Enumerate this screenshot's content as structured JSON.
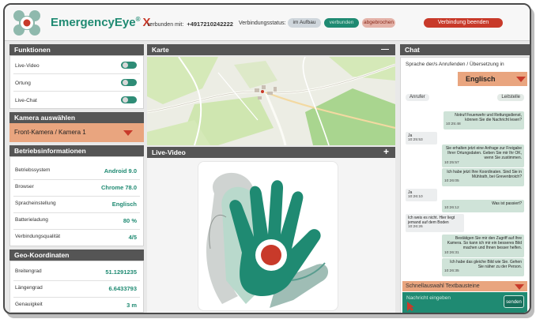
{
  "app": {
    "brand": "EmergencyEye",
    "brand_suffix": "X",
    "reg_mark": "®"
  },
  "header": {
    "connected_label": "verbunden mit:",
    "phone": "+4917210242222",
    "status_label": "Verbindungsstatus:",
    "status_building": "im Aufbau",
    "status_connected": "verbunden",
    "status_aborted": "abgebrochen",
    "end_button": "Verbindung beenden"
  },
  "functions": {
    "title": "Funktionen",
    "items": [
      {
        "label": "Live-Video",
        "on": true
      },
      {
        "label": "Ortung",
        "on": true
      },
      {
        "label": "Live-Chat",
        "on": true
      }
    ]
  },
  "camera": {
    "title": "Kamera auswählen",
    "selected": "Front-Kamera / Kamera 1"
  },
  "operating": {
    "title": "Betriebsinformationen",
    "rows": [
      {
        "label": "Betriebssystem",
        "value": "Android 9.0"
      },
      {
        "label": "Browser",
        "value": "Chrome 78.0"
      },
      {
        "label": "Spracheinstellung",
        "value": "Englisch"
      },
      {
        "label": "Batterieladung",
        "value": "80 %"
      },
      {
        "label": "Verbindungsqualität",
        "value": "4/5"
      }
    ]
  },
  "geo": {
    "title": "Geo-Koordinaten",
    "rows": [
      {
        "label": "Breitengrad",
        "value": "51.1291235"
      },
      {
        "label": "Längengrad",
        "value": "6.6433793"
      },
      {
        "label": "Genauigkeit",
        "value": "3 m"
      }
    ]
  },
  "map": {
    "title": "Karte",
    "collapse_symbol": "—"
  },
  "video": {
    "title": "Live-Video",
    "expand_symbol": "+"
  },
  "chat": {
    "title": "Chat",
    "language_label": "Sprache der/s Anrufenden / Übersetzung in",
    "language": "Englisch",
    "caller_tab": "Anrufer",
    "control_tab": "Leitstelle",
    "messages": [
      {
        "side": "right",
        "text": "Notruf Feuerwehr und Rettungsdienst, können Sie die Nachricht lesen?",
        "time": "10:25:48"
      },
      {
        "side": "left",
        "text": "Ja",
        "time": "10:25:53"
      },
      {
        "side": "right",
        "text": "Sie erhalten jetzt eine Anfrage zur Freigabe Ihrer Ortungsdaten. Geben Sie mir Ihr OK, wenn Sie zustimmen.",
        "time": "10:25:57"
      },
      {
        "side": "right",
        "text": "Ich habe jetzt Ihre Koordinaten. Sind Sie in Mühlrath, bei Grevenbroich?",
        "time": "10:26:05"
      },
      {
        "side": "left",
        "text": "Ja",
        "time": "10:26:10"
      },
      {
        "side": "right",
        "text": "Was ist passiert?",
        "time": "10:26:12"
      },
      {
        "side": "left",
        "text": "Ich weis es nicht. Hier liegt jemand auf dem Boden",
        "time": "10:26:26"
      },
      {
        "side": "right",
        "text": "Bestätigen Sie mir den Zugriff auf Ihre Kamera. So kann ich mir ein besseres Bild machen und Ihnen besser helfen.",
        "time": "10:26:31"
      },
      {
        "side": "right",
        "text": "Ich habe das gleiche Bild wie Sie. Gehen Sie näher zu der Person.",
        "time": "10:26:35"
      }
    ],
    "quick_select": "Schnellauswahl Textbausteine",
    "input_placeholder": "Nachricht eingeben",
    "send": "senden"
  },
  "colors": {
    "teal": "#1f8a72",
    "red": "#c83a2a",
    "orange": "#e9a57f",
    "panel_header": "#555555"
  }
}
